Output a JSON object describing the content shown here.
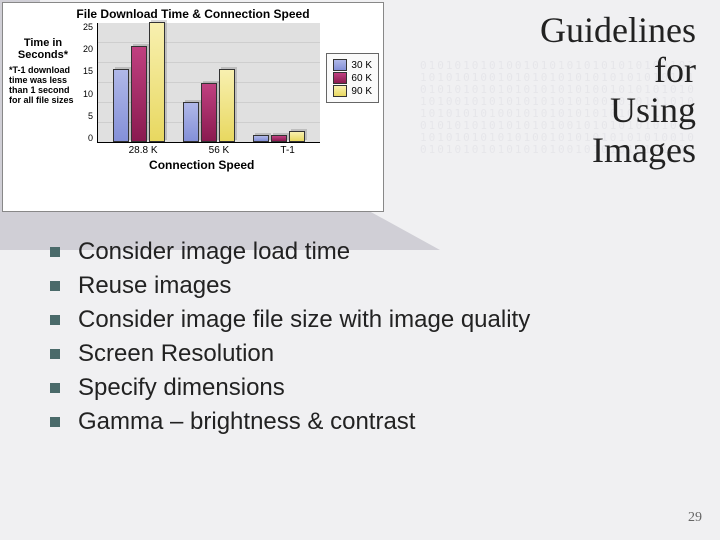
{
  "title_lines": [
    "Guidelines",
    "for",
    "Using",
    "Images"
  ],
  "page_number": "29",
  "bullets": [
    "Consider image load time",
    "Reuse images",
    "Consider image file size with image quality",
    "Screen Resolution",
    "Specify dimensions",
    "Gamma – brightness & contrast"
  ],
  "chart_data": {
    "type": "bar",
    "title": "File Download Time & Connection Speed",
    "ylabel": "Time in Seconds*",
    "xlabel": "Connection Speed",
    "footnote": "*T-1 download time was less than 1 second for all file sizes",
    "categories": [
      "28.8 K",
      "56 K",
      "T-1"
    ],
    "series": [
      {
        "name": "30 K",
        "values": [
          15,
          8,
          1
        ]
      },
      {
        "name": "60 K",
        "values": [
          20,
          12,
          1
        ]
      },
      {
        "name": "90 K",
        "values": [
          25,
          15,
          2
        ]
      }
    ],
    "ylim": [
      0,
      25
    ],
    "yticks": [
      "25",
      "20",
      "15",
      "10",
      "5",
      "0"
    ],
    "legend": [
      "30 K",
      "60 K",
      "90 K"
    ]
  }
}
